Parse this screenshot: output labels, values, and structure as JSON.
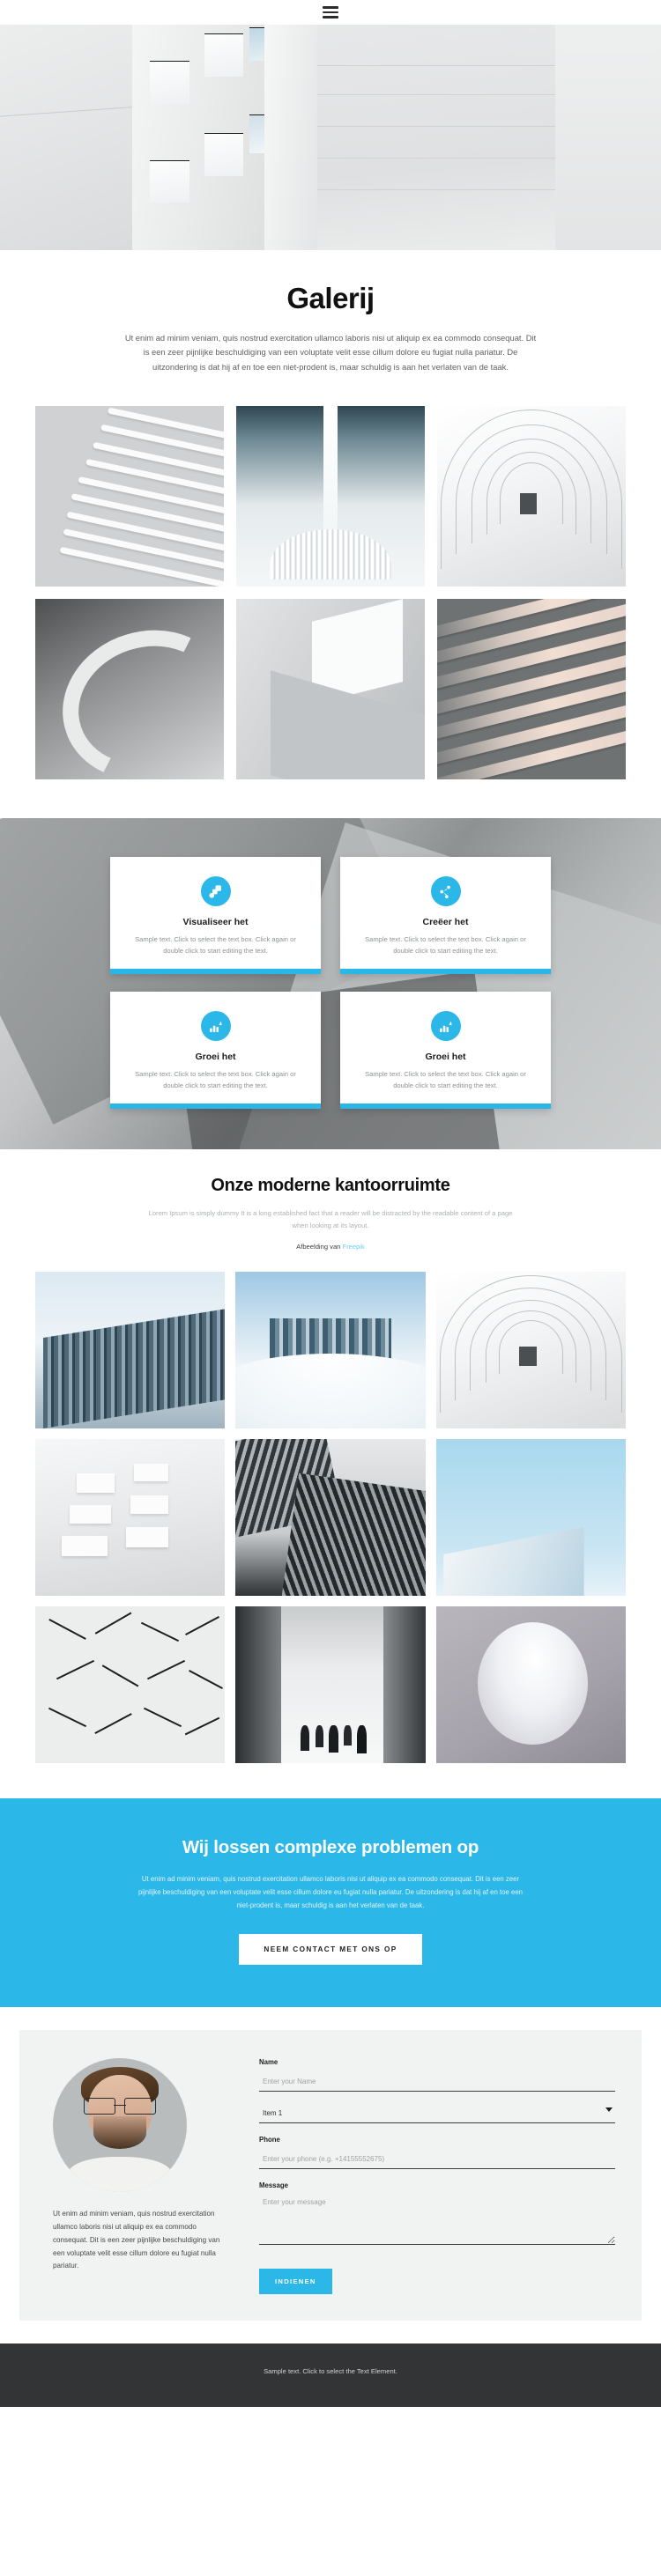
{
  "header": {
    "menu_icon": "hamburger-menu-icon"
  },
  "intro": {
    "title": "Galerij",
    "paragraph": "Ut enim ad minim veniam, quis nostrud exercitation ullamco laboris nisi ut aliquip ex ea commodo consequat. Dit is een zeer pijnlijke beschuldiging van een voluptate velit esse cillum dolore eu fugiat nulla pariatur. De uitzondering is dat hij af en toe een niet-prodent is, maar schuldig is aan het verlaten van de taak."
  },
  "gallery_one": {
    "items": [
      {
        "alt": "white louvered facade"
      },
      {
        "alt": "white atrium interior"
      },
      {
        "alt": "white curved corridor"
      },
      {
        "alt": "concrete spiral staircase"
      },
      {
        "alt": "abstract folded white surface"
      },
      {
        "alt": "pink balcony facade"
      }
    ]
  },
  "features": {
    "cards": [
      {
        "icon": "layers-icon",
        "title": "Visualiseer het",
        "text": "Sample text. Click to select the text box. Click again or double click to start editing the text."
      },
      {
        "icon": "share-node-icon",
        "title": "Creëer het",
        "text": "Sample text. Click to select the text box. Click again or double click to start editing the text."
      },
      {
        "icon": "bar-chart-up-icon",
        "title": "Groei het",
        "text": "Sample text. Click to select the text box. Click again or double click to start editing the text."
      },
      {
        "icon": "bar-chart-up-icon",
        "title": "Groei het",
        "text": "Sample text. Click to select the text box. Click again or double click to start editing the text."
      }
    ],
    "accent_color": "#2bb7e8"
  },
  "office": {
    "title": "Onze moderne kantoorruimte",
    "subtitle": "Lorem Ipsum is simply dummy It is a long established fact that a reader will be distracted by the readable content of a page when looking at its layout.",
    "credit_prefix": "Afbeelding van ",
    "credit_link": "Freepik",
    "gallery": {
      "items": [
        {
          "alt": "modern glass office building"
        },
        {
          "alt": "skyscrapers above the fog"
        },
        {
          "alt": "white curved corridor"
        },
        {
          "alt": "white apartment building balconies"
        },
        {
          "alt": "looking up at dark skyscrapers"
        },
        {
          "alt": "building corner against blue sky"
        },
        {
          "alt": "triangular white wall pattern"
        },
        {
          "alt": "people walking in bright hall"
        },
        {
          "alt": "oval skylight spiral"
        }
      ]
    }
  },
  "cta": {
    "title": "Wij lossen complexe problemen op",
    "paragraph": "Ut enim ad minim veniam, quis nostrud exercitation ullamco laboris nisi ut aliquip ex ea commodo consequat. Dit is een zeer pijnlijke beschuldiging van een voluptate velit esse cillum dolore eu fugiat nulla pariatur. De uitzondering is dat hij af en toe een niet-prodent is, maar schuldig is aan het verlaten van de taak.",
    "button_label": "NEEM CONTACT MET ONS OP",
    "background_color": "#2bb7e8"
  },
  "contact": {
    "avatar_alt": "portrait of a man with glasses",
    "paragraph": "Ut enim ad minim veniam, quis nostrud exercitation ullamco laboris nisi ut aliquip ex ea commodo consequat. Dit is een zeer pijnlijke beschuldiging van een voluptate velit esse cillum dolore eu fugiat nulla pariatur.",
    "form": {
      "name_label": "Name",
      "name_placeholder": "Enter your Name",
      "select_value": "Item 1",
      "select_options": [
        "Item 1"
      ],
      "phone_label": "Phone",
      "phone_placeholder": "Enter your phone (e.g. +14155552675)",
      "message_label": "Message",
      "message_placeholder": "Enter your message",
      "submit_label": "INDIENEN"
    }
  },
  "footer": {
    "text": "Sample text. Click to select the Text Element."
  }
}
